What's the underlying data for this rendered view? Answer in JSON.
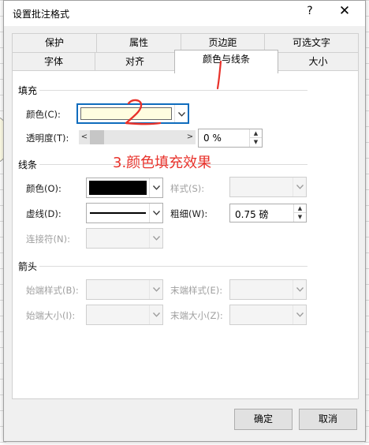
{
  "dialog": {
    "title": "设置批注格式",
    "help_icon": "?",
    "close_icon": "✕"
  },
  "tabs_row1": [
    "保护",
    "属性",
    "页边距",
    "可选文字"
  ],
  "tabs_row2": [
    "字体",
    "对齐",
    "颜色与线条",
    "大小"
  ],
  "active_tab": "颜色与线条",
  "fill": {
    "section": "填充",
    "color_label": "颜色(C):",
    "color_value": "#fffde0",
    "transparency_label": "透明度(T):",
    "transparency_value": "0 %",
    "transparency_fraction": 0
  },
  "line": {
    "section": "线条",
    "color_label": "颜色(O):",
    "color_value": "#000000",
    "dash_label": "虚线(D):",
    "connector_label": "连接符(N):",
    "style_label": "样式(S):",
    "weight_label": "粗细(W):",
    "weight_value": "0.75 磅"
  },
  "arrows": {
    "section": "箭头",
    "begin_style_label": "始端样式(B):",
    "begin_size_label": "始端大小(I):",
    "end_style_label": "末端样式(E):",
    "end_size_label": "末端大小(Z):"
  },
  "buttons": {
    "ok": "确定",
    "cancel": "取消"
  },
  "annotations": {
    "mark_1": "1",
    "mark_2": "2",
    "caption": "3.颜色填充效果",
    "color": "#e8322b"
  }
}
